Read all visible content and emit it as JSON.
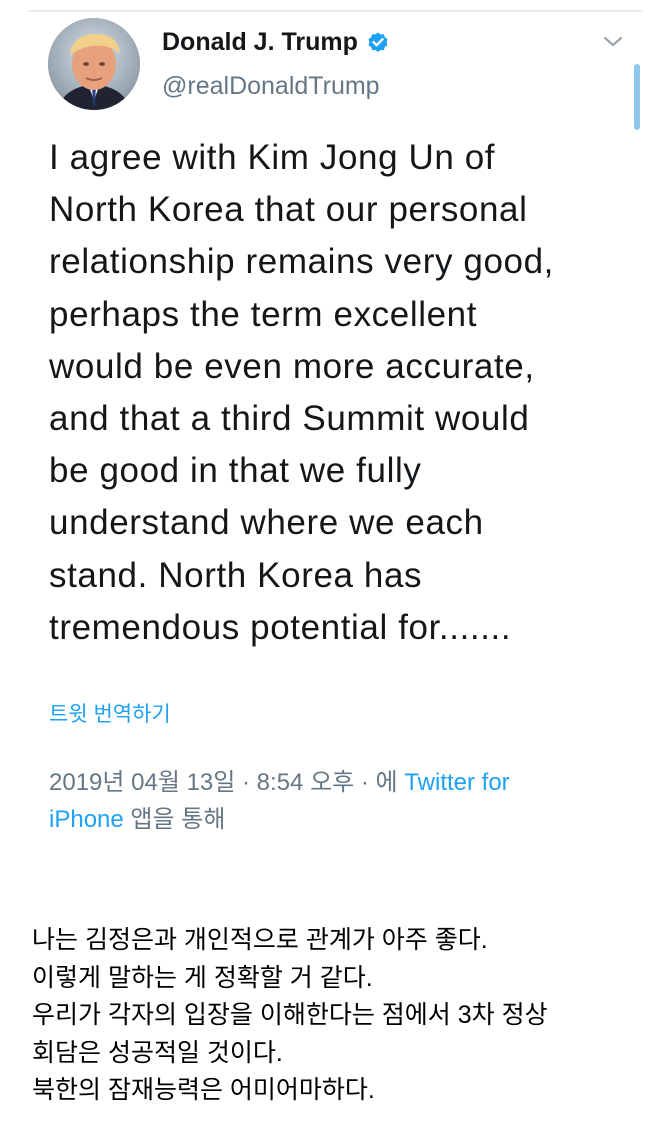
{
  "tweet": {
    "author": {
      "display_name": "Donald J. Trump",
      "handle": "@realDonaldTrump",
      "verified": true
    },
    "text_lines": [
      "I agree with Kim Jong Un of",
      "North Korea that our personal",
      "relationship remains very good,",
      "perhaps the term excellent",
      "would be even more accurate,",
      "and that a third Summit would",
      "be good in that we fully",
      "understand where we each",
      "stand. North Korea has",
      "tremendous potential for......."
    ],
    "translate_label": "트윗 번역하기",
    "meta": {
      "timestamp": "2019년 04월 13일 · 8:54 오후 · 에",
      "source_part1": "Twitter for",
      "source_part2": "iPhone",
      "suffix": "앱을 통해"
    }
  },
  "caption_lines": [
    "나는 김정은과 개인적으로 관계가 아주 좋다.",
    "이렇게 말하는 게 정확할 거 같다.",
    "우리가 각자의 입장을 이해한다는 점에서 3차 정상",
    "회담은 성공적일 것이다.",
    "북한의 잠재능력은 어미어마하다."
  ],
  "colors": {
    "link_blue": "#1da1f2",
    "secondary_gray": "#657786",
    "text_dark": "#14171a"
  },
  "icons": {
    "verified": "verified-badge-icon",
    "menu": "chevron-down-icon"
  }
}
